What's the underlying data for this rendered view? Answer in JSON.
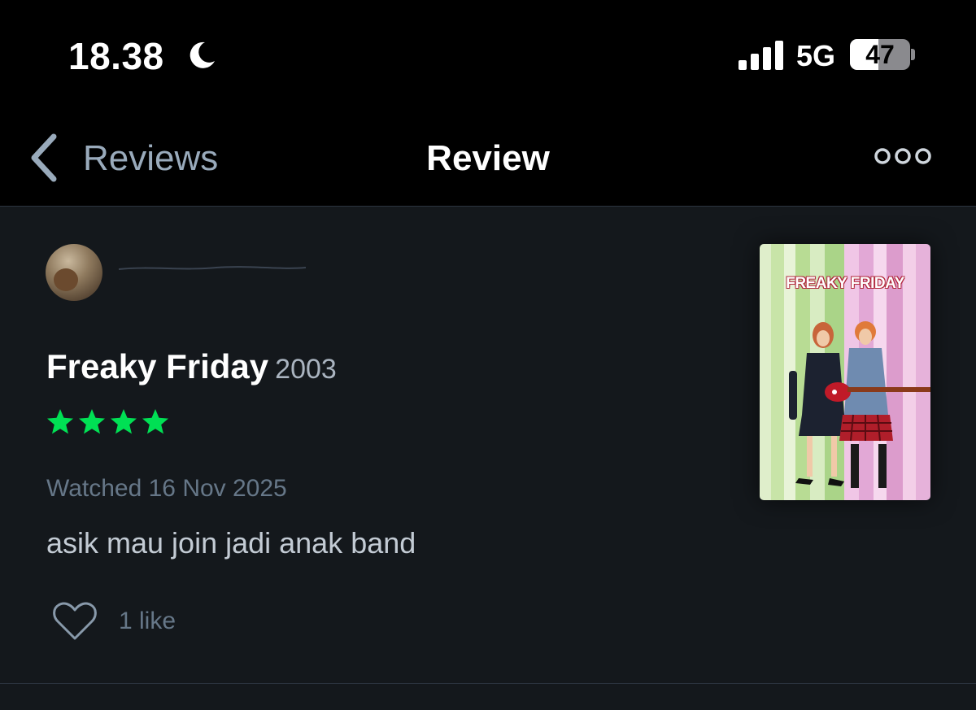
{
  "status_bar": {
    "time": "18.38",
    "network": "5G",
    "battery": "47",
    "battery_level": 0.47
  },
  "nav": {
    "back_label": "Reviews",
    "title": "Review"
  },
  "review": {
    "film_title": "Freaky Friday",
    "year": "2003",
    "rating_stars": 4,
    "watched": "Watched 16 Nov 2025",
    "text": "asik mau join jadi anak band",
    "likes": "1 like"
  },
  "poster": {
    "title": "FREAKY FRIDAY"
  },
  "colors": {
    "background": "#14181c",
    "star": "#00e054",
    "muted": "#667788"
  },
  "icons": [
    "moon-icon",
    "signal-icon",
    "back-chevron-icon",
    "more-icon",
    "star-icon",
    "heart-icon"
  ]
}
